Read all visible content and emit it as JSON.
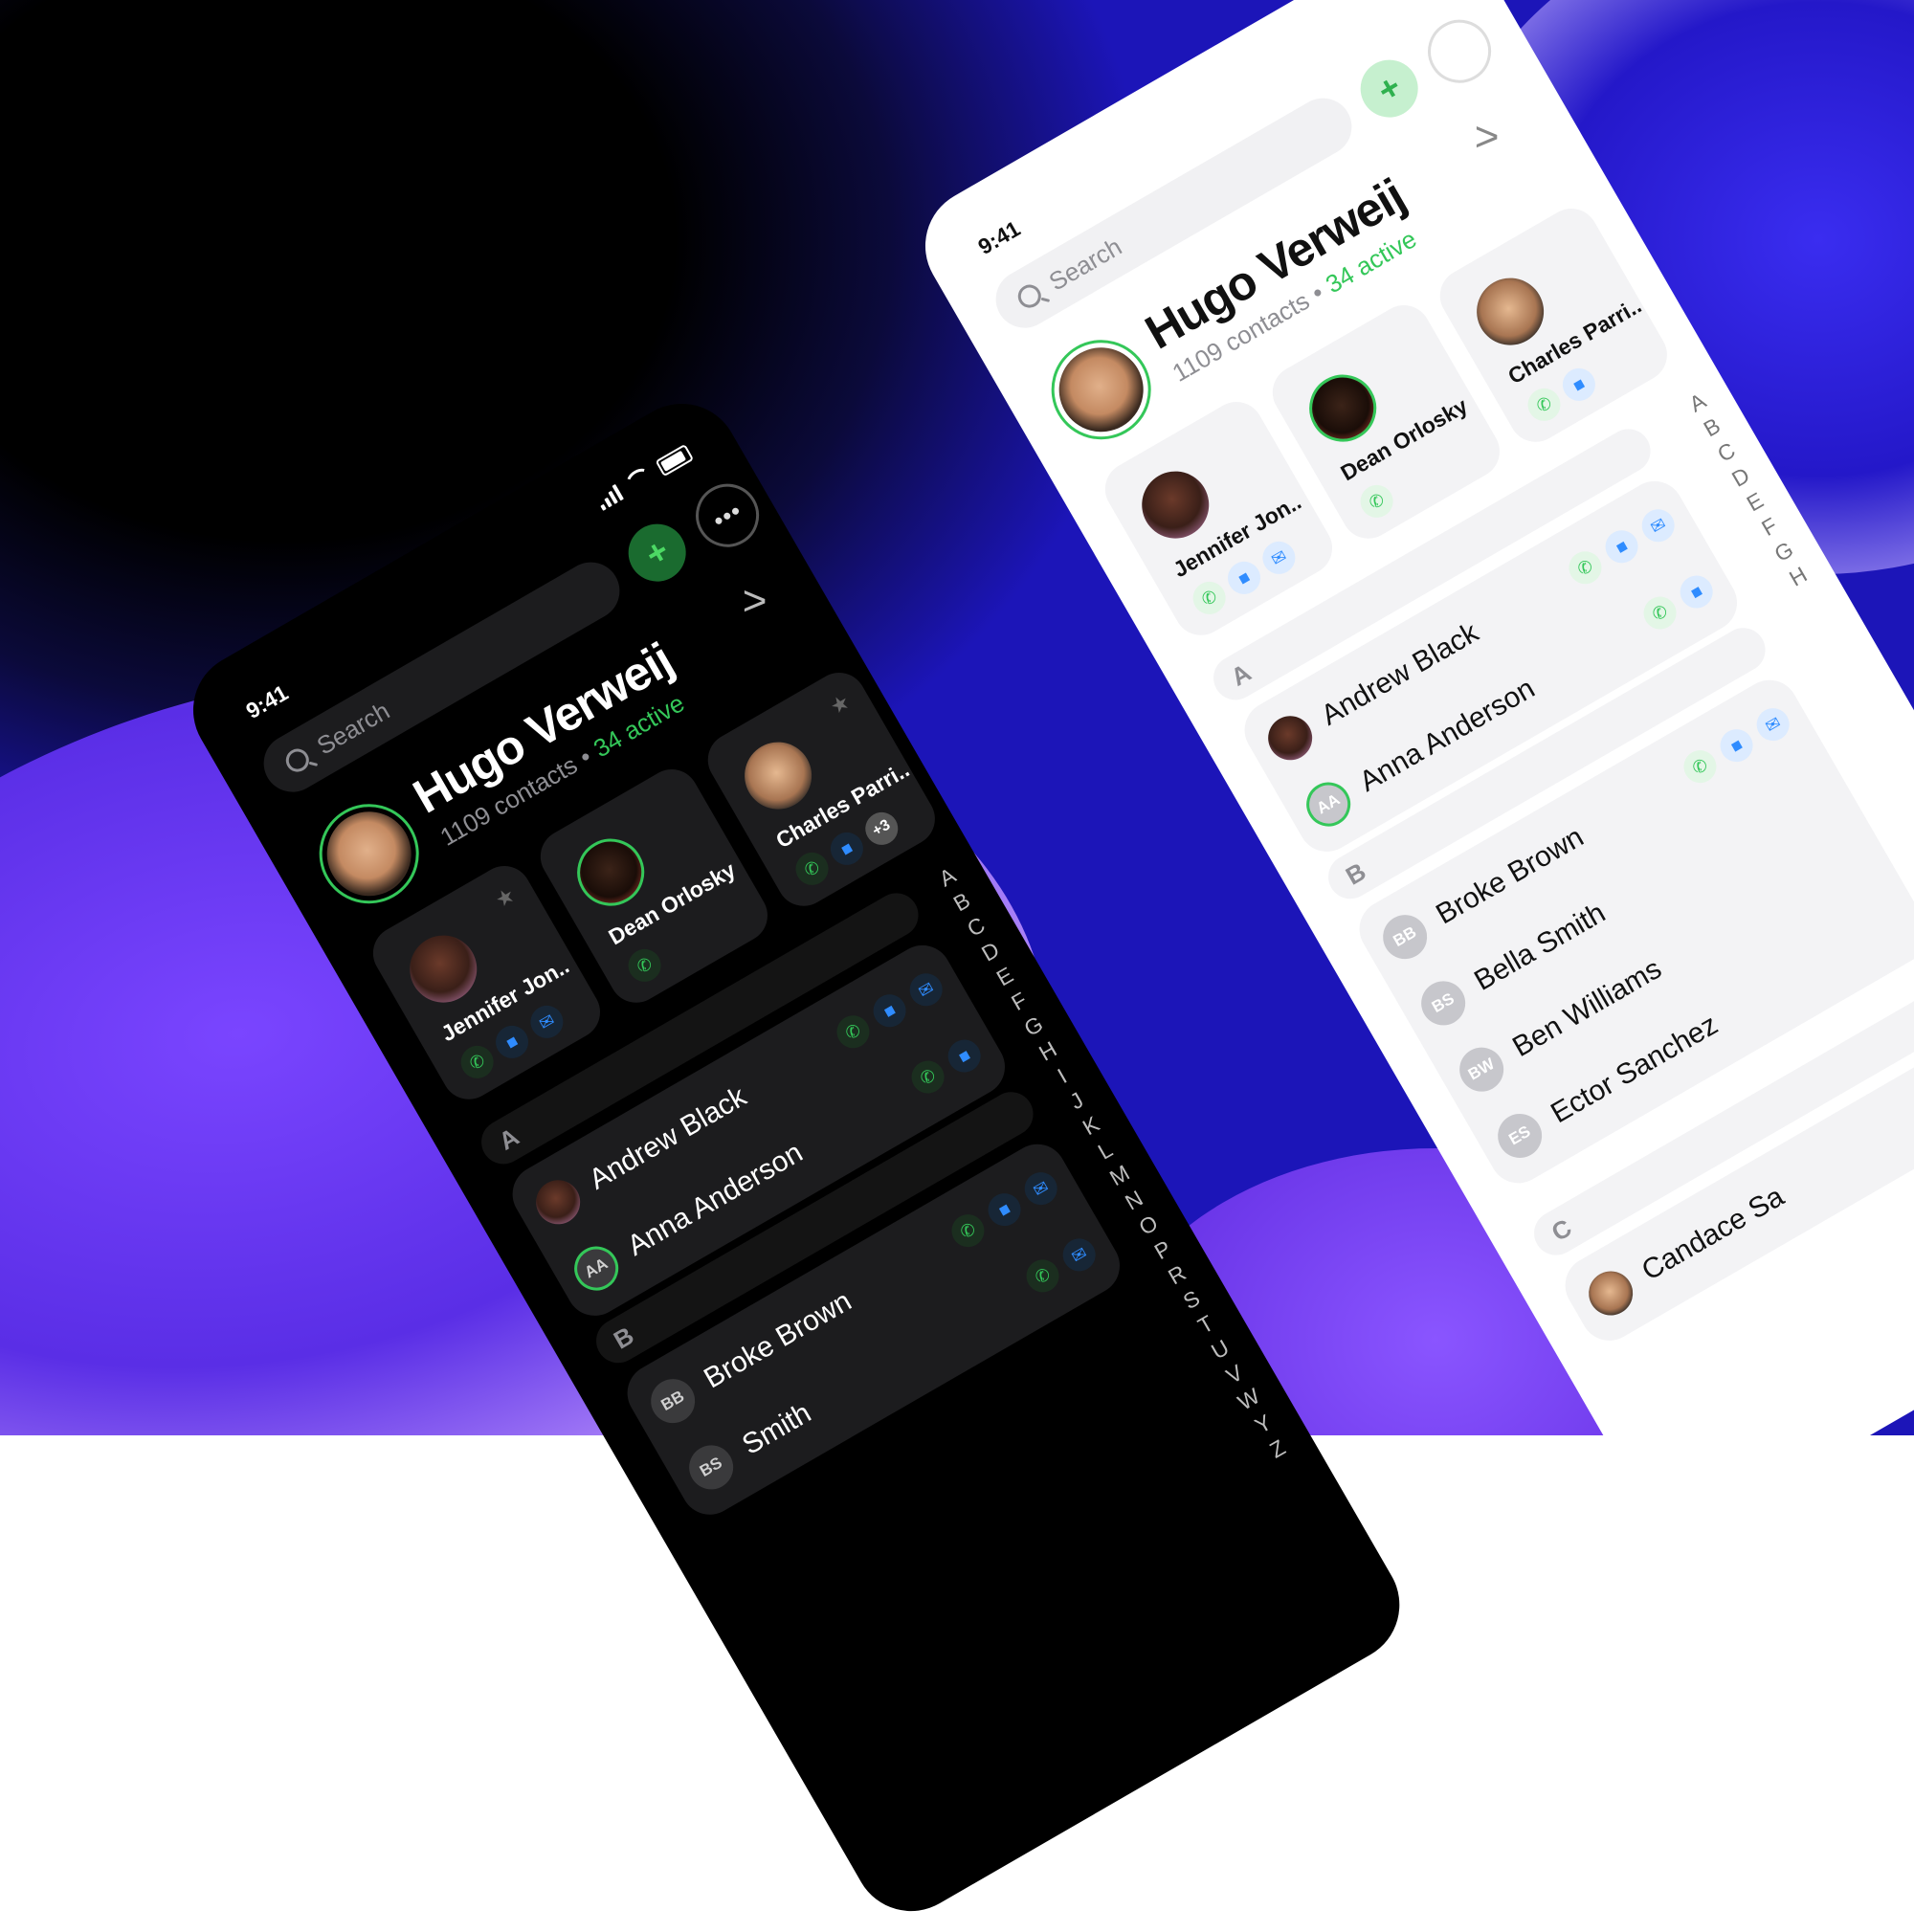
{
  "status": {
    "time": "9:41"
  },
  "search": {
    "placeholder": "Search"
  },
  "header": {
    "add_label": "+",
    "more_label": "•••",
    "chevron": ">"
  },
  "profile": {
    "name": "Hugo Verweij",
    "contacts": "1109 contacts",
    "separator": "•",
    "active": "34 active"
  },
  "favorites": [
    {
      "name": "Jennifer Jon..",
      "actions": [
        "call",
        "video",
        "mail"
      ]
    },
    {
      "name": "Dean Orlosky",
      "actions": [
        "call"
      ]
    },
    {
      "name": "Charles Parri..",
      "actions": [
        "call",
        "video"
      ],
      "extra": "+3"
    }
  ],
  "index_letters": [
    "A",
    "B",
    "C",
    "D",
    "E",
    "F",
    "G",
    "H",
    "I",
    "J",
    "K",
    "L",
    "M",
    "N",
    "O",
    "P",
    "R",
    "S",
    "T",
    "U",
    "V",
    "W",
    "Y",
    "Z"
  ],
  "light_index_letters": [
    "A",
    "B",
    "C",
    "D",
    "E",
    "F",
    "G",
    "H"
  ],
  "sections": [
    {
      "letter": "A",
      "contacts": [
        {
          "name": "Andrew Black",
          "initials": "",
          "actions": [
            "call",
            "video",
            "mail"
          ]
        },
        {
          "name": "Anna Anderson",
          "initials": "AA",
          "actions": [
            "call",
            "video"
          ]
        }
      ]
    },
    {
      "letter": "B",
      "contacts": [
        {
          "name": "Broke Brown",
          "initials": "BB",
          "actions": [
            "call",
            "video",
            "mail"
          ]
        },
        {
          "name": "Bella Smith",
          "initials": "BS",
          "actions": [
            "call"
          ]
        },
        {
          "name": "Ben Williams",
          "initials": "BW",
          "actions": []
        },
        {
          "name": "Ector Sanchez",
          "initials": "ES",
          "actions": []
        }
      ]
    },
    {
      "letter": "C",
      "contacts": [
        {
          "name": "Candace Sa",
          "initials": "",
          "actions": []
        }
      ]
    }
  ],
  "dark_smith_partial": "Smith",
  "colors": {
    "accent_green": "#34c759",
    "accent_blue": "#2f8cff"
  }
}
